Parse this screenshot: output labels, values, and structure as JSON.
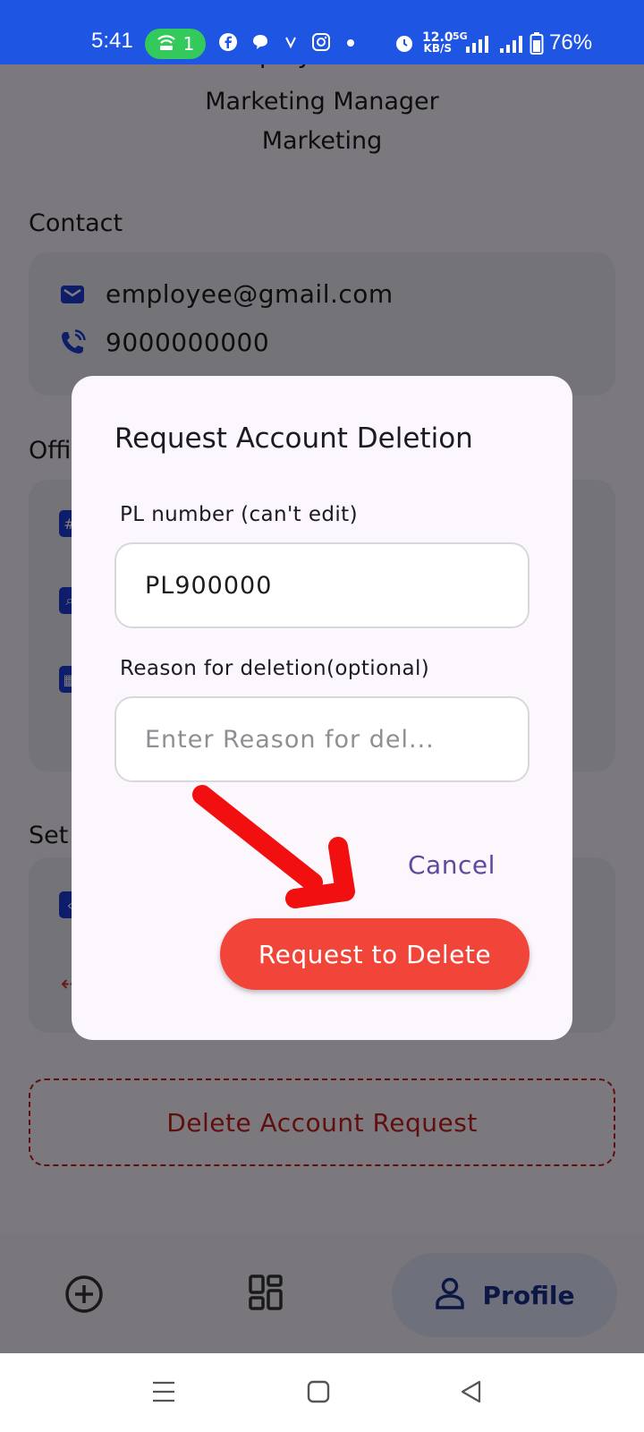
{
  "status_bar": {
    "time": "5:41",
    "hotspot_count": "1",
    "net_speed_value": "12.0",
    "net_speed_unit": "KB/S",
    "network_type": "5G",
    "battery": "76%"
  },
  "profile": {
    "name_cut": "Employee Name",
    "designation": "Marketing Manager",
    "department": "Marketing"
  },
  "contact": {
    "section_label": "Contact",
    "email": "employee@gmail.com",
    "phone": "9000000000"
  },
  "office": {
    "section_label": "Offi"
  },
  "settings": {
    "section_label": "Set"
  },
  "delete_account_label": "Delete Account Request",
  "bottom_nav": {
    "profile_label": "Profile"
  },
  "dialog": {
    "title": "Request Account Deletion",
    "pl_label": "PL number (can't edit)",
    "pl_value": "PL900000",
    "reason_label": "Reason for deletion(optional)",
    "reason_placeholder": "Enter Reason for del...",
    "cancel_label": "Cancel",
    "request_label": "Request to Delete"
  },
  "colors": {
    "accent": "#1b3bd3",
    "danger": "#f2453a",
    "status_bar": "#1f55e3",
    "hotspot": "#34c95b",
    "cancel_text": "#5b4a9e"
  }
}
